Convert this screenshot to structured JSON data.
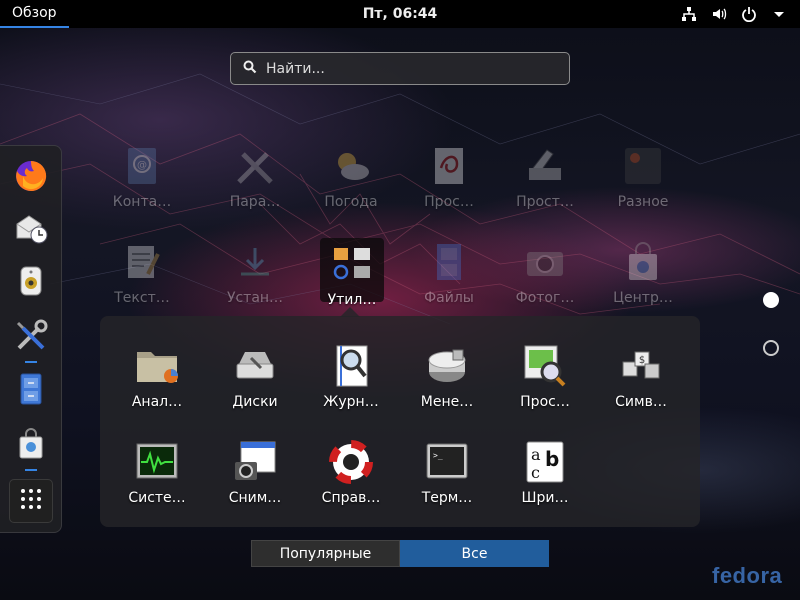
{
  "topbar": {
    "activities": "Обзор",
    "clock": "Пт, 06:44",
    "tray_icons": [
      "network-wired-icon",
      "volume-icon",
      "power-icon",
      "dropdown-arrow-icon"
    ]
  },
  "search": {
    "placeholder": "Найти..."
  },
  "dash": {
    "items": [
      {
        "name": "firefox",
        "icon": "firefox-icon",
        "running": false
      },
      {
        "name": "evolution",
        "icon": "mail-clock-icon",
        "running": false
      },
      {
        "name": "rhythmbox",
        "icon": "speaker-icon",
        "running": false
      },
      {
        "name": "utilities",
        "icon": "wrench-screwdriver-icon",
        "running": true
      },
      {
        "name": "files",
        "icon": "file-cabinet-icon",
        "running": false
      },
      {
        "name": "software",
        "icon": "shopping-bag-icon",
        "running": true
      },
      {
        "name": "show-applications",
        "icon": "grid-icon",
        "running": false
      }
    ]
  },
  "grid": {
    "row1": [
      "Конта…",
      "Пара…",
      "Погода",
      "Прос…",
      "Прост…",
      "Разное"
    ],
    "row2": [
      "Текст…",
      "Устан…",
      "Утил…",
      "Файлы",
      "Фотог…",
      "Центр…"
    ]
  },
  "folder": {
    "row1": [
      "Анал…",
      "Диски",
      "Журн…",
      "Мене…",
      "Прос…",
      "Симв…"
    ],
    "row2": [
      "Систе…",
      "Сним…",
      "Справ…",
      "Терм…",
      "Шри…"
    ]
  },
  "pager": {
    "pages": 2,
    "current": 1
  },
  "view_switch": {
    "frequent": "Популярные",
    "all": "Все",
    "selected": "all"
  },
  "brand": "fedora",
  "colors": {
    "accent": "#3584e4",
    "selected_button": "#215d9c",
    "topbar": "#000000"
  }
}
